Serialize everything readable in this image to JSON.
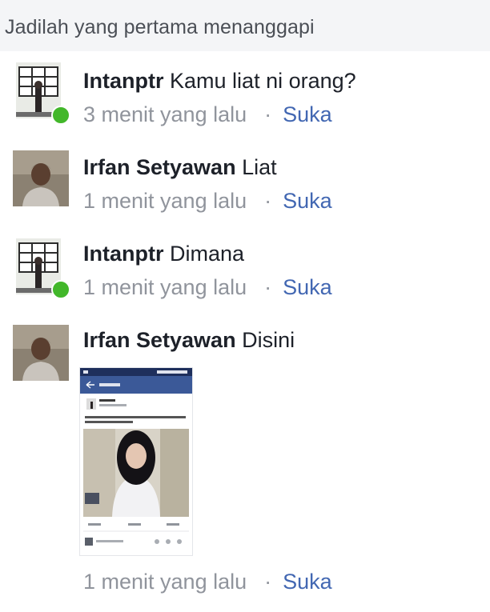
{
  "header": {
    "title": "Jadilah yang pertama menanggapi"
  },
  "comments": [
    {
      "author": "Intanptr",
      "text": "Kamu liat ni orang?",
      "time": "3 menit yang lalu",
      "like": "Suka"
    },
    {
      "author": "Irfan Setyawan",
      "text": "Liat",
      "time": "1 menit yang lalu",
      "like": "Suka"
    },
    {
      "author": "Intanptr",
      "text": "Dimana",
      "time": "1 menit yang lalu",
      "like": "Suka"
    },
    {
      "author": "Irfan Setyawan",
      "text": "Disini",
      "time": "1 menit yang lalu",
      "like": "Suka"
    }
  ],
  "meta_separator": "·",
  "attachment": {
    "type": "screenshot of a post"
  },
  "colors": {
    "like_link": "#4267b2",
    "meta_text": "#90949c",
    "online": "#42b72a"
  }
}
